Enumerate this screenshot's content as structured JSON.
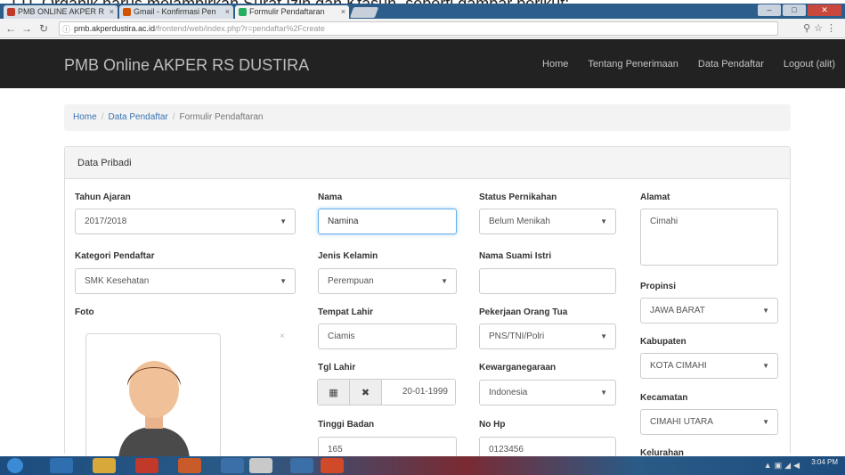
{
  "document_strip": {
    "text": "TTI, Organik harus melampirkan Surat Izin dan Ktasun, seperti gambar berikut:"
  },
  "browser": {
    "tabs": [
      {
        "label": "PMB ONLINE AKPER R",
        "color": "#c0392b"
      },
      {
        "label": "Gmail - Konfirmasi Pen",
        "color": "#d35400"
      },
      {
        "label": "Formulir Pendaftaran",
        "color": "#27ae60"
      }
    ],
    "url": {
      "host": "pmb.akperdustira.ac.id",
      "path": "/frontend/web/index.php?r=pendaftar%2Fcreate"
    },
    "window_controls": {
      "minimize": "–",
      "maximize": "□",
      "close": "✕"
    }
  },
  "navbar": {
    "brand": "PMB Online AKPER RS DUSTIRA",
    "links": [
      "Home",
      "Tentang Penerimaan",
      "Data Pendaftar",
      "Logout (alit)"
    ]
  },
  "breadcrumb": {
    "items": [
      "Home",
      "Data Pendaftar",
      "Formulir Pendaftaran"
    ],
    "separator": "/"
  },
  "panel": {
    "heading": "Data Pribadi"
  },
  "form": {
    "tahun_ajaran": {
      "label": "Tahun Ajaran",
      "value": "2017/2018"
    },
    "kategori": {
      "label": "Kategori Pendaftar",
      "value": "SMK Kesehatan"
    },
    "foto": {
      "label": "Foto",
      "remove": "×"
    },
    "nama": {
      "label": "Nama",
      "value": "Namina"
    },
    "jenis_kelamin": {
      "label": "Jenis Kelamin",
      "value": "Perempuan"
    },
    "tempat_lahir": {
      "label": "Tempat Lahir",
      "value": "Ciamis"
    },
    "tgl_lahir": {
      "label": "Tgl Lahir",
      "value": "20-01-1999"
    },
    "tinggi_badan": {
      "label": "Tinggi Badan",
      "value": "165"
    },
    "status": {
      "label": "Status Pernikahan",
      "value": "Belum Menikah"
    },
    "nama_suami_istri": {
      "label": "Nama Suami Istri",
      "value": ""
    },
    "pekerjaan": {
      "label": "Pekerjaan Orang Tua",
      "value": "PNS/TNI/Polri"
    },
    "kewarganegaraan": {
      "label": "Kewarganegaraan",
      "value": "Indonesia"
    },
    "no_hp": {
      "label": "No Hp",
      "value": "0123456"
    },
    "alamat": {
      "label": "Alamat",
      "value": "Cimahi"
    },
    "propinsi": {
      "label": "Propinsi",
      "value": "JAWA BARAT"
    },
    "kabupaten": {
      "label": "Kabupaten",
      "value": "KOTA CIMAHI"
    },
    "kecamatan": {
      "label": "Kecamatan",
      "value": "CIMAHI UTARA"
    },
    "kelurahan": {
      "label": "Kelurahan"
    }
  },
  "icons": {
    "calendar": "calendar-icon",
    "clear": "remove-icon",
    "caret": "caret-down-icon"
  },
  "taskbar": {
    "clock": "3:04 PM"
  }
}
